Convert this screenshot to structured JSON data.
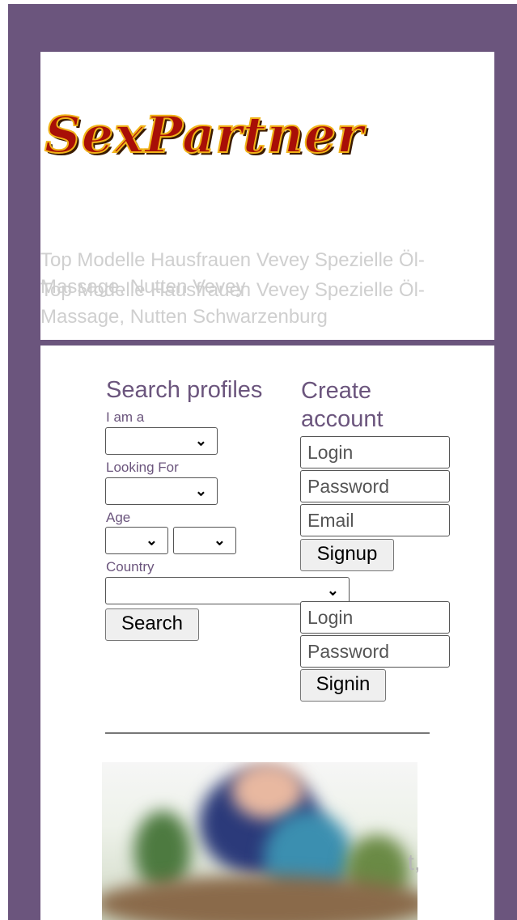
{
  "brand": {
    "logo_text": "SexPartner"
  },
  "header": {
    "tagline_1": "Top Modelle Hausfrauen Vevey Spezielle Öl-Massage, Nutten Vevey",
    "tagline_2": "Top Modelle Hausfrauen Vevey Spezielle Öl-Massage, Nutten Schwarzenburg"
  },
  "search": {
    "title": "Search profiles",
    "i_am_label": "I am a",
    "looking_for_label": "Looking For",
    "age_label": "Age",
    "country_label": "Country",
    "search_button": "Search"
  },
  "register": {
    "title": "Create account",
    "login_placeholder": "Login",
    "password_placeholder": "Password",
    "email_placeholder": "Email",
    "signup_button": "Signup"
  },
  "signin": {
    "login_placeholder": "Login",
    "password_placeholder": "Password",
    "signin_button": "Signin"
  },
  "content": {
    "partial_text": "t,"
  },
  "colors": {
    "frame": "#6b557d",
    "logo_fill": "#a80f07",
    "logo_outline": "#f1b319"
  }
}
